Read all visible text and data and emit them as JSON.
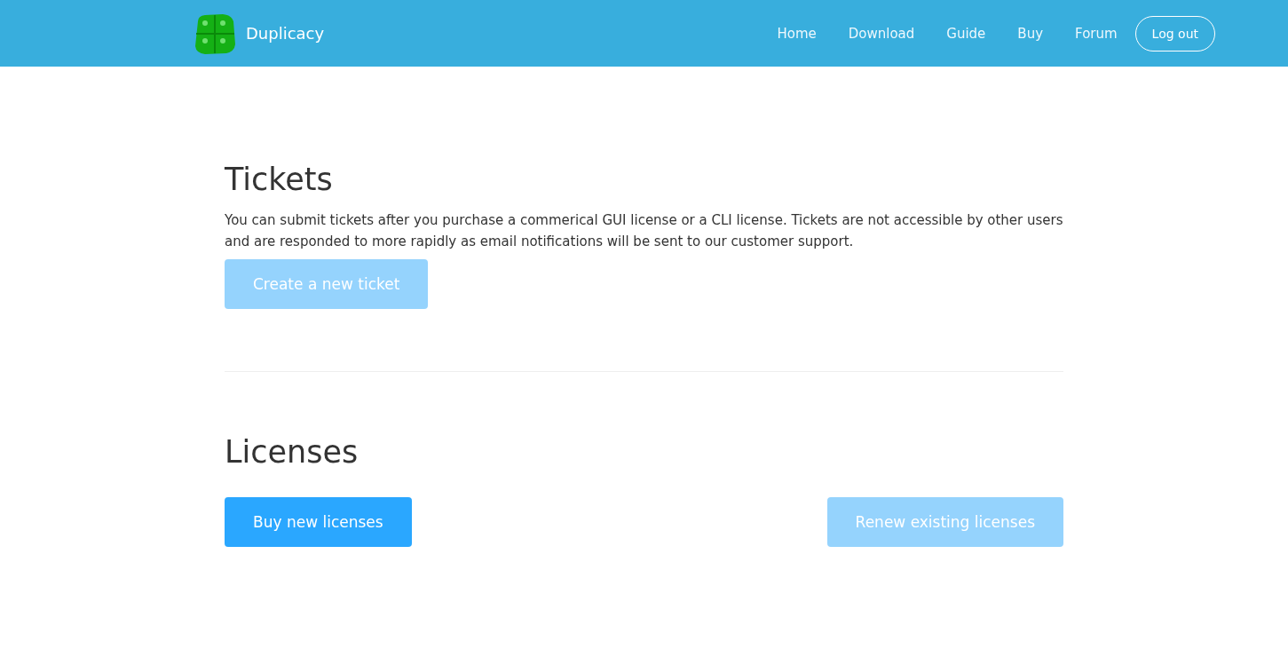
{
  "header": {
    "brand": "Duplicacy",
    "nav": [
      {
        "label": "Home"
      },
      {
        "label": "Download"
      },
      {
        "label": "Guide"
      },
      {
        "label": "Buy"
      },
      {
        "label": "Forum"
      }
    ],
    "logout": "Log out"
  },
  "tickets": {
    "title": "Tickets",
    "text": "You can submit tickets after you purchase a commerical GUI license or a CLI license. Tickets are not accessible by other users and are responded to more rapidly as email notifications will be sent to our customer support.",
    "button": {
      "label": "Create a new ticket",
      "disabled": true
    }
  },
  "licenses": {
    "title": "Licenses",
    "buttons": [
      {
        "label": "Buy new licenses",
        "disabled": false
      },
      {
        "label": "Renew existing licenses",
        "disabled": true
      }
    ]
  }
}
